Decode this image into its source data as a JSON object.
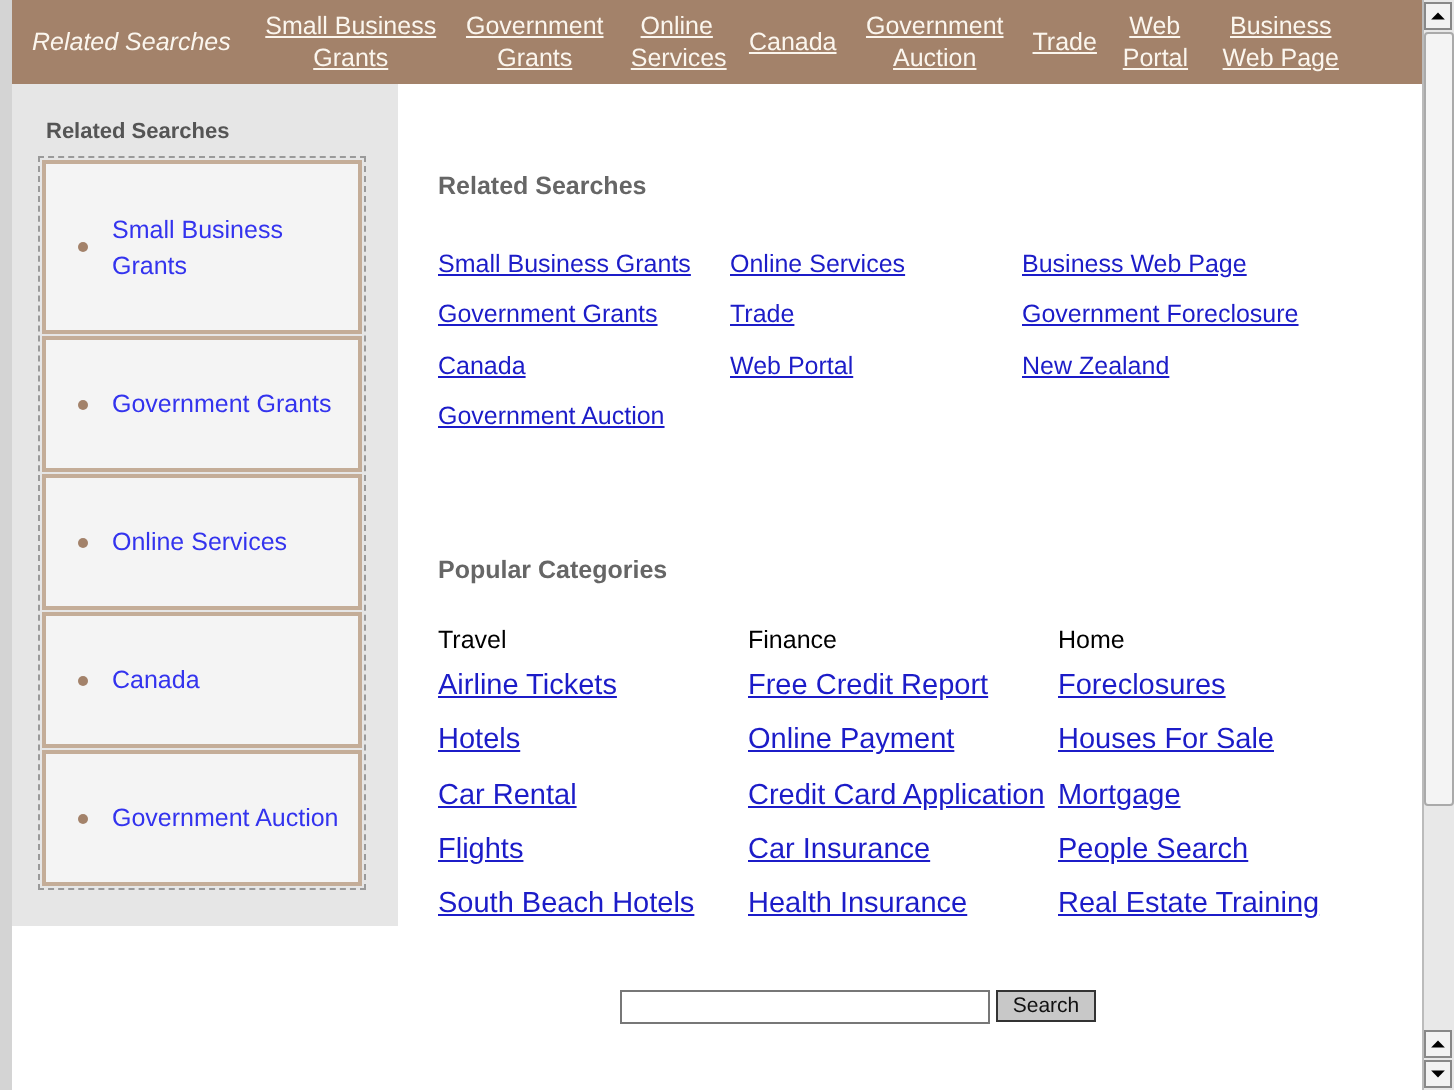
{
  "top_bar": {
    "title": "Related Searches",
    "links": [
      {
        "label": "Small Business Grants"
      },
      {
        "label": "Government Grants"
      },
      {
        "label": "Online Services"
      },
      {
        "label": "Canada"
      },
      {
        "label": "Government Auction"
      },
      {
        "label": "Trade"
      },
      {
        "label": "Web Portal"
      },
      {
        "label": "Business Web Page"
      }
    ]
  },
  "sidebar": {
    "title": "Related Searches",
    "items": [
      {
        "label": "Small Business Grants"
      },
      {
        "label": "Government Grants"
      },
      {
        "label": "Online Services"
      },
      {
        "label": "Canada"
      },
      {
        "label": "Government Auction"
      }
    ]
  },
  "related": {
    "title": "Related Searches",
    "columns": [
      [
        "Small Business Grants",
        "Government Grants",
        "Canada",
        "Government Auction"
      ],
      [
        "Online Services",
        "Trade",
        "Web Portal"
      ],
      [
        "Business Web Page",
        "Government Foreclosure",
        "New Zealand"
      ]
    ]
  },
  "popular": {
    "title": "Popular Categories",
    "categories": [
      {
        "name": "Travel",
        "links": [
          "Airline Tickets",
          "Hotels",
          "Car Rental",
          "Flights",
          "South Beach Hotels"
        ]
      },
      {
        "name": "Finance",
        "links": [
          "Free Credit Report",
          "Online Payment",
          "Credit Card Application",
          "Car Insurance",
          "Health Insurance"
        ]
      },
      {
        "name": "Home",
        "links": [
          "Foreclosures",
          "Houses For Sale",
          "Mortgage",
          "People Search",
          "Real Estate Training"
        ]
      }
    ]
  },
  "search": {
    "button": "Search"
  }
}
